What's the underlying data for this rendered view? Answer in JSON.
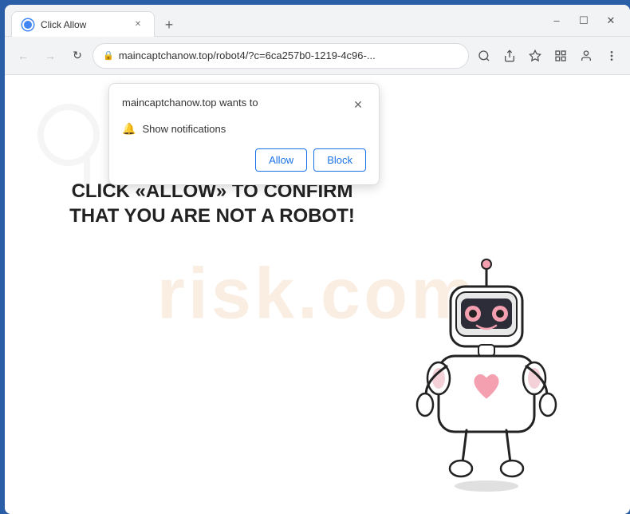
{
  "window": {
    "title": "Click Allow",
    "controls": {
      "minimize": "–",
      "maximize": "☐",
      "close": "✕"
    }
  },
  "tab": {
    "favicon_alt": "site-icon",
    "title": "Click Allow",
    "close_btn": "✕",
    "new_tab_btn": "+"
  },
  "address_bar": {
    "url": "maincaptchanow.top/robot4/?c=6ca257b0-1219-4c96-...",
    "lock_icon": "🔒"
  },
  "nav": {
    "back": "←",
    "forward": "→",
    "reload": "↻",
    "search_icon": "🔍",
    "share_icon": "⎋",
    "bookmark_icon": "☆",
    "extensions_icon": "⬚",
    "profile_icon": "👤",
    "menu_icon": "⋮"
  },
  "popup": {
    "title": "maincaptchanow.top wants to",
    "close_btn": "✕",
    "permission_icon": "🔔",
    "permission_text": "Show notifications",
    "allow_btn": "Allow",
    "block_btn": "Block"
  },
  "page": {
    "watermark": "risk.com",
    "captcha_text": "CLICK «ALLOW» TO CONFIRM THAT YOU ARE NOT A ROBOT!"
  },
  "colors": {
    "browser_border": "#2a5fa8",
    "allow_btn_color": "#1a73e8",
    "block_btn_color": "#1a73e8",
    "captcha_text_color": "#222222",
    "watermark_color": "rgba(230,160,100,0.18)"
  }
}
